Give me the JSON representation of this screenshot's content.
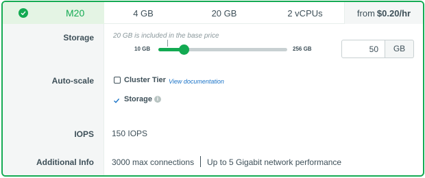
{
  "header": {
    "tier_name": "M20",
    "ram": "4 GB",
    "storage": "20 GB",
    "vcpus": "2 vCPUs",
    "price_prefix": "from",
    "price_value": "$0.20/hr"
  },
  "labels": {
    "storage": "Storage",
    "autoscale": "Auto-scale",
    "iops": "IOPS",
    "additional_info": "Additional Info"
  },
  "storage": {
    "note": "20 GB is included in the base price",
    "slider_min_label": "10 GB",
    "slider_max_label": "256 GB",
    "slider_min": 10,
    "slider_max": 256,
    "slider_value": 50,
    "input_value": "50",
    "unit": "GB"
  },
  "autoscale": {
    "cluster_tier_label": "Cluster Tier",
    "cluster_tier_checked": false,
    "view_docs_link": "View documentation",
    "storage_label": "Storage",
    "storage_checked": true,
    "info_glyph": "i"
  },
  "iops": {
    "value": "150 IOPS"
  },
  "additional_info": {
    "connections": "3000 max connections",
    "network": "Up to 5 Gigabit network performance"
  },
  "colors": {
    "accent": "#13aa52",
    "selected_bg": "#e4f4e4",
    "text": "#3d4f58",
    "link": "#1a73c7"
  }
}
